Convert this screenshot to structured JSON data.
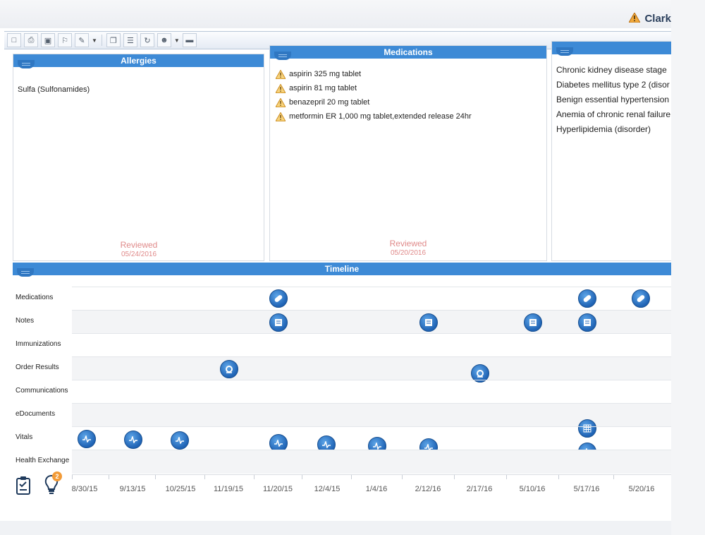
{
  "header": {
    "patient_name": "Clark"
  },
  "toolbar": {
    "buttons": [
      "new-doc-icon",
      "print-icon",
      "save-icon",
      "bookmark-icon",
      "edit-icon",
      "copy-icon",
      "list-icon",
      "refresh-icon",
      "contacts-icon",
      "card-icon"
    ]
  },
  "allergies": {
    "title": "Allergies",
    "items": [
      "Sulfa (Sulfonamides)"
    ],
    "reviewed_label": "Reviewed",
    "reviewed_date": "05/24/2016"
  },
  "medications": {
    "title": "Medications",
    "items": [
      "aspirin 325 mg tablet",
      "aspirin 81 mg tablet",
      "benazepril 20 mg tablet",
      "metformin ER 1,000 mg tablet,extended release 24hr"
    ],
    "reviewed_label": "Reviewed",
    "reviewed_date": "05/20/2016"
  },
  "problems": {
    "items": [
      "Chronic kidney disease stage",
      "Diabetes mellitus type 2 (disor",
      "Benign essential hypertension",
      "Anemia of chronic renal failure",
      "Hyperlipidemia (disorder)"
    ]
  },
  "timeline": {
    "title": "Timeline",
    "rows": [
      {
        "label": "Medications"
      },
      {
        "label": "Notes"
      },
      {
        "label": "Immunizations"
      },
      {
        "label": "Order Results"
      },
      {
        "label": "Communications"
      },
      {
        "label": "eDocuments"
      },
      {
        "label": "Vitals"
      },
      {
        "label": "Health Exchange"
      }
    ],
    "dates": [
      "8/30/15",
      "9/13/15",
      "10/25/15",
      "11/19/15",
      "11/20/15",
      "12/4/15",
      "1/4/16",
      "2/12/16",
      "2/17/16",
      "5/10/16",
      "5/17/16",
      "5/20/16"
    ]
  },
  "bottom": {
    "badge_count": "2"
  }
}
